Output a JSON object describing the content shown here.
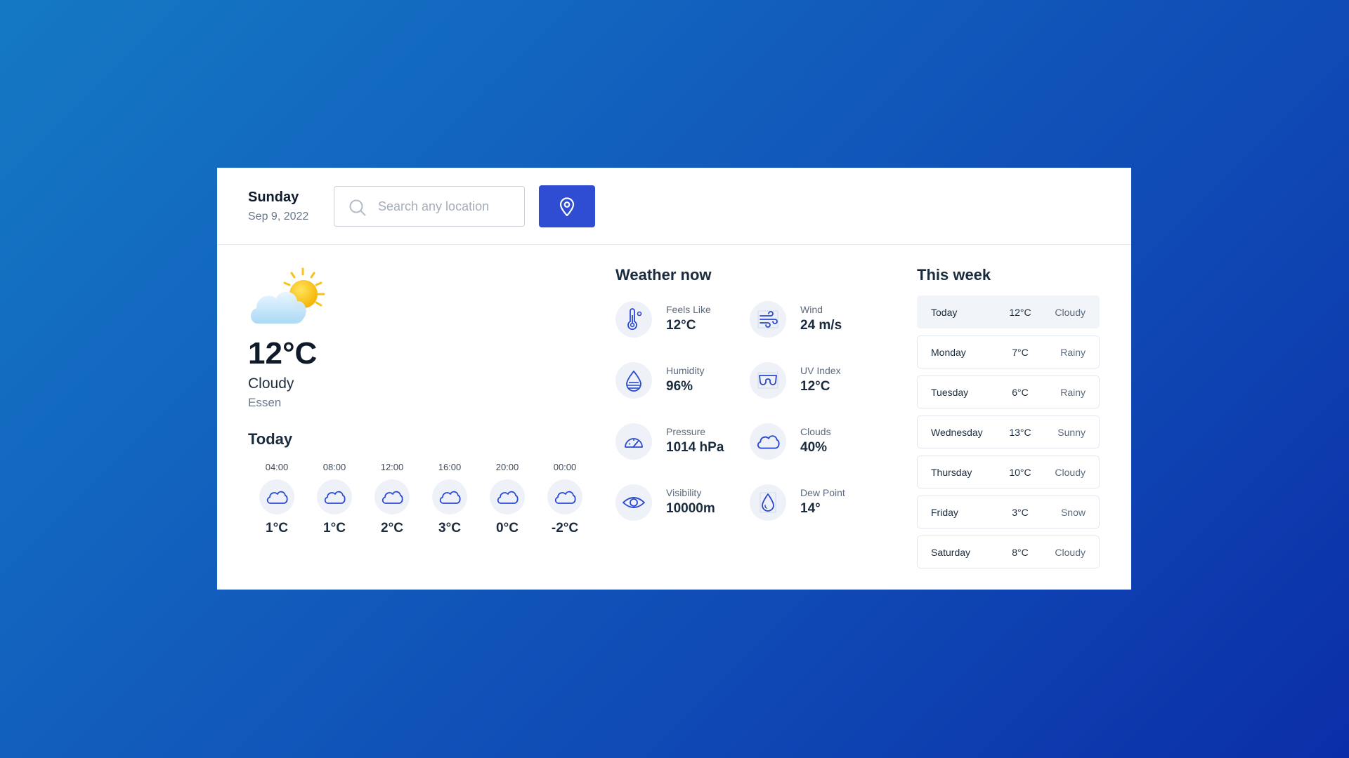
{
  "header": {
    "day": "Sunday",
    "date": "Sep 9, 2022",
    "search_placeholder": "Search any location"
  },
  "current": {
    "temp": "12°C",
    "condition": "Cloudy",
    "city": "Essen",
    "icon": "partly-cloudy-icon"
  },
  "today": {
    "title": "Today",
    "hours": [
      {
        "time": "04:00",
        "temp": "1°C",
        "icon": "cloud-icon"
      },
      {
        "time": "08:00",
        "temp": "1°C",
        "icon": "cloud-icon"
      },
      {
        "time": "12:00",
        "temp": "2°C",
        "icon": "cloud-icon"
      },
      {
        "time": "16:00",
        "temp": "3°C",
        "icon": "cloud-icon"
      },
      {
        "time": "20:00",
        "temp": "0°C",
        "icon": "cloud-icon"
      },
      {
        "time": "00:00",
        "temp": "-2°C",
        "icon": "cloud-icon"
      }
    ]
  },
  "now": {
    "title": "Weather now",
    "metrics": [
      {
        "label": "Feels Like",
        "value": "12°C",
        "icon": "thermometer-icon"
      },
      {
        "label": "Wind",
        "value": "24 m/s",
        "icon": "wind-icon"
      },
      {
        "label": "Humidity",
        "value": "96%",
        "icon": "humidity-icon"
      },
      {
        "label": "UV  Index",
        "value": "12°C",
        "icon": "sunglasses-icon"
      },
      {
        "label": "Pressure",
        "value": "1014 hPa",
        "icon": "gauge-icon"
      },
      {
        "label": "Clouds",
        "value": "40%",
        "icon": "cloud-icon"
      },
      {
        "label": "Visibility",
        "value": "10000m",
        "icon": "eye-icon"
      },
      {
        "label": "Dew Point",
        "value": "14°",
        "icon": "droplet-icon"
      }
    ]
  },
  "week": {
    "title": "This week",
    "days": [
      {
        "day": "Today",
        "temp": "12°C",
        "cond": "Cloudy"
      },
      {
        "day": "Monday",
        "temp": "7°C",
        "cond": "Rainy"
      },
      {
        "day": "Tuesday",
        "temp": "6°C",
        "cond": "Rainy"
      },
      {
        "day": "Wednesday",
        "temp": "13°C",
        "cond": "Sunny"
      },
      {
        "day": "Thursday",
        "temp": "10°C",
        "cond": "Cloudy"
      },
      {
        "day": "Friday",
        "temp": "3°C",
        "cond": "Snow"
      },
      {
        "day": "Saturday",
        "temp": "8°C",
        "cond": "Cloudy"
      }
    ]
  },
  "colors": {
    "accent": "#2f4dd3",
    "icon_stroke": "#2a48d0",
    "background_start": "#1479c4",
    "background_end": "#0b2ea8"
  }
}
